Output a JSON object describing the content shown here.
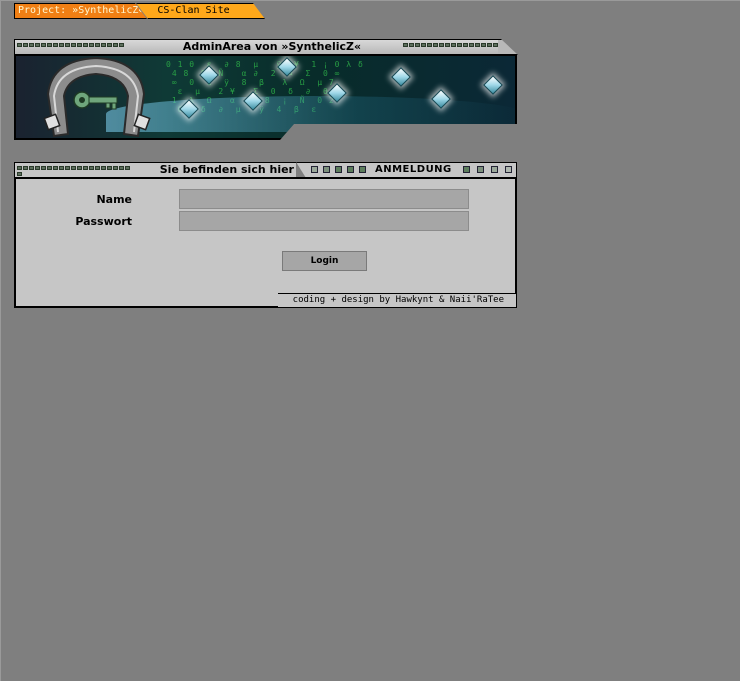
{
  "tabs": {
    "project": "Project: »SynthelicZ«",
    "clan": "CS-Clan Site"
  },
  "banner": {
    "title": "AdminArea von »SynthelicZ«"
  },
  "panel": {
    "location_label": "Sie befinden sich hier",
    "section": "ANMELDUNG"
  },
  "form": {
    "name_label": "Name",
    "name_value": "",
    "password_label": "Passwort",
    "password_value": "",
    "login_label": "Login"
  },
  "footer": {
    "credits": "coding + design by Hawkynt & Naii'RaTee"
  },
  "colors": {
    "background": "#7f7f7f",
    "tab_project": "#f07f14",
    "tab_clan": "#ffa81a",
    "panel": "#c6c6c6",
    "input": "#a6a6a6"
  },
  "icons": [
    "key-icon",
    "horseshoe-logo-icon"
  ]
}
